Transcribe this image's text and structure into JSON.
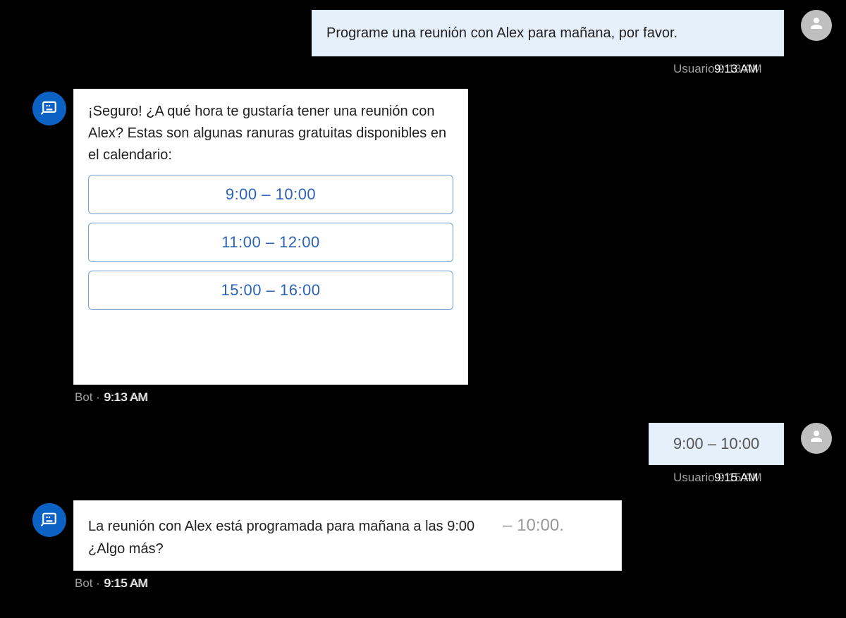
{
  "messages": {
    "user1": {
      "text": "Programe una reunión con Alex para mañana, por favor.",
      "sender": "Usuario",
      "time": "9:13 AM",
      "ghost_meta": "Usuario 9:13 AM"
    },
    "bot1": {
      "text": "¡Seguro! ¿A qué hora te gustaría tener una reunión con Alex? Estas son algunas ranuras gratuitas disponibles en el calendario:",
      "slots": [
        "9:00 – 10:00",
        "11:00 – 12:00",
        "15:00 – 16:00"
      ],
      "sender": "Bot",
      "time": "9:13 AM",
      "ghost_meta": "Bot · 9:13 AM"
    },
    "user2": {
      "text": "9:00 – 10:00",
      "sender": "Usuario",
      "time": "9:15 AM",
      "ghost_meta": "Usuario 9:15 AM"
    },
    "bot2": {
      "text_main": "La reunión con Alex está programada para mañana a las 9:00",
      "text_time_tail": "– 10:00.",
      "text_follow": "¿Algo más?",
      "sender": "Bot",
      "time": "9:15 AM",
      "ghost_meta": "Bot · 9:15 AM"
    }
  },
  "icons": {
    "user": "person-icon",
    "bot": "bot-icon"
  }
}
